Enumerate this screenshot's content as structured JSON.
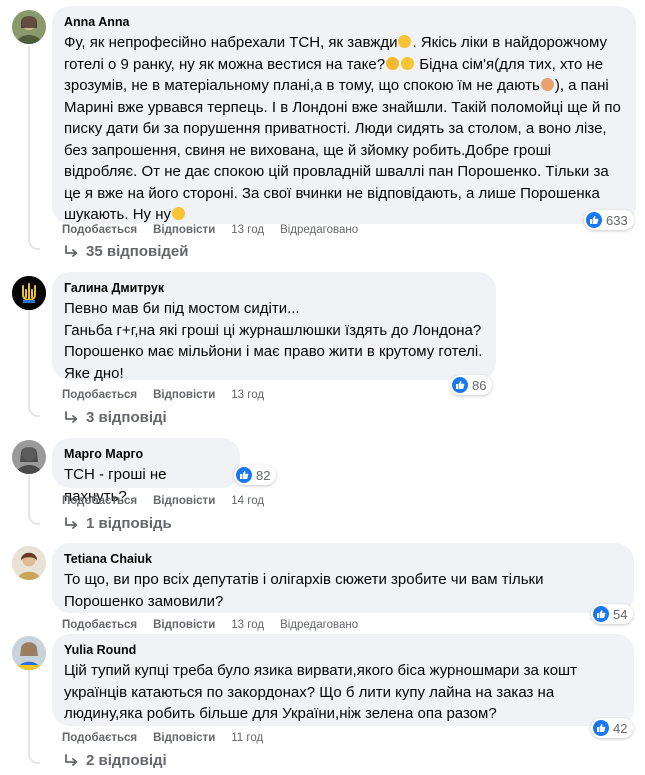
{
  "comments": [
    {
      "author": "Anna Anna",
      "text_parts": [
        "Фу, як непрофесійно набрехали ТСН, як завжди",
        ". Якісь ліки в найдорожчому готелі о 9 ранку, ну як можна вестися на таке?",
        " Бідна сім'я(для тих, хто не зрозумів, не в матеріальному плані,а в тому, що спокою їм не дають",
        "), а пані Марині вже урвався терпець. І в Лондоні вже знайшли. Такій поломойці ще й по писку дати би за порушення приватності. Люди сидять за столом, а воно лізе, без запрошення, свиня не вихована, ще й зйомку робить.Добре гроші відробляє. От не дає спокою цій провладній шваллі пан Порошенко. Тільки за це я вже на його стороні. За свої вчинки не відповідають, а лише Порошенка шукають. Ну ну"
      ],
      "reactions": "633",
      "like_label": "Подобається",
      "reply_label": "Відповісти",
      "time": "13 год",
      "edited": "Відредаговано",
      "replies_label": "35 відповідей"
    },
    {
      "author": "Галина Дмитрук",
      "text": "Певно мав би під мостом сидіти...\nГаньба г+г,на які гроші ці журнашлюшки їздять до Лондона?\nПорошенко має мільйони і має право жити в крутому готелі.\nЯке дно!",
      "reactions": "86",
      "like_label": "Подобається",
      "reply_label": "Відповісти",
      "time": "13 год",
      "replies_label": "3 відповіді"
    },
    {
      "author": "Марго Марго",
      "text": "ТСН - гроші не пахнуть?",
      "reactions": "82",
      "like_label": "Подобається",
      "reply_label": "Відповісти",
      "time": "14 год",
      "replies_label": "1 відповідь"
    },
    {
      "author": "Tetiana Chaiuk",
      "text": "То що, ви про всіх депутатів і олігархів сюжети зробите чи вам тільки\nПорошенко замовили?",
      "reactions": "54",
      "like_label": "Подобається",
      "reply_label": "Відповісти",
      "time": "13 год",
      "edited": "Відредаговано"
    },
    {
      "author": "Yulia Round",
      "text": "Цій тупий купці треба було язика вирвати,якого біса журношмари за кошт\nукраїнців катаються по закордонах? Що б лити купу лайна на заказ на\nлюдину,яка робить більше для України,ніж зелена опа разом?",
      "reactions": "42",
      "like_label": "Подобається",
      "reply_label": "Відповісти",
      "time": "11 год",
      "replies_label": "2 відповіді"
    }
  ],
  "colors": {
    "bubble": "#f0f2f5",
    "like_blue": "#1877f2",
    "meta_gray": "#65676b",
    "thread_line": "#e4e6eb"
  }
}
